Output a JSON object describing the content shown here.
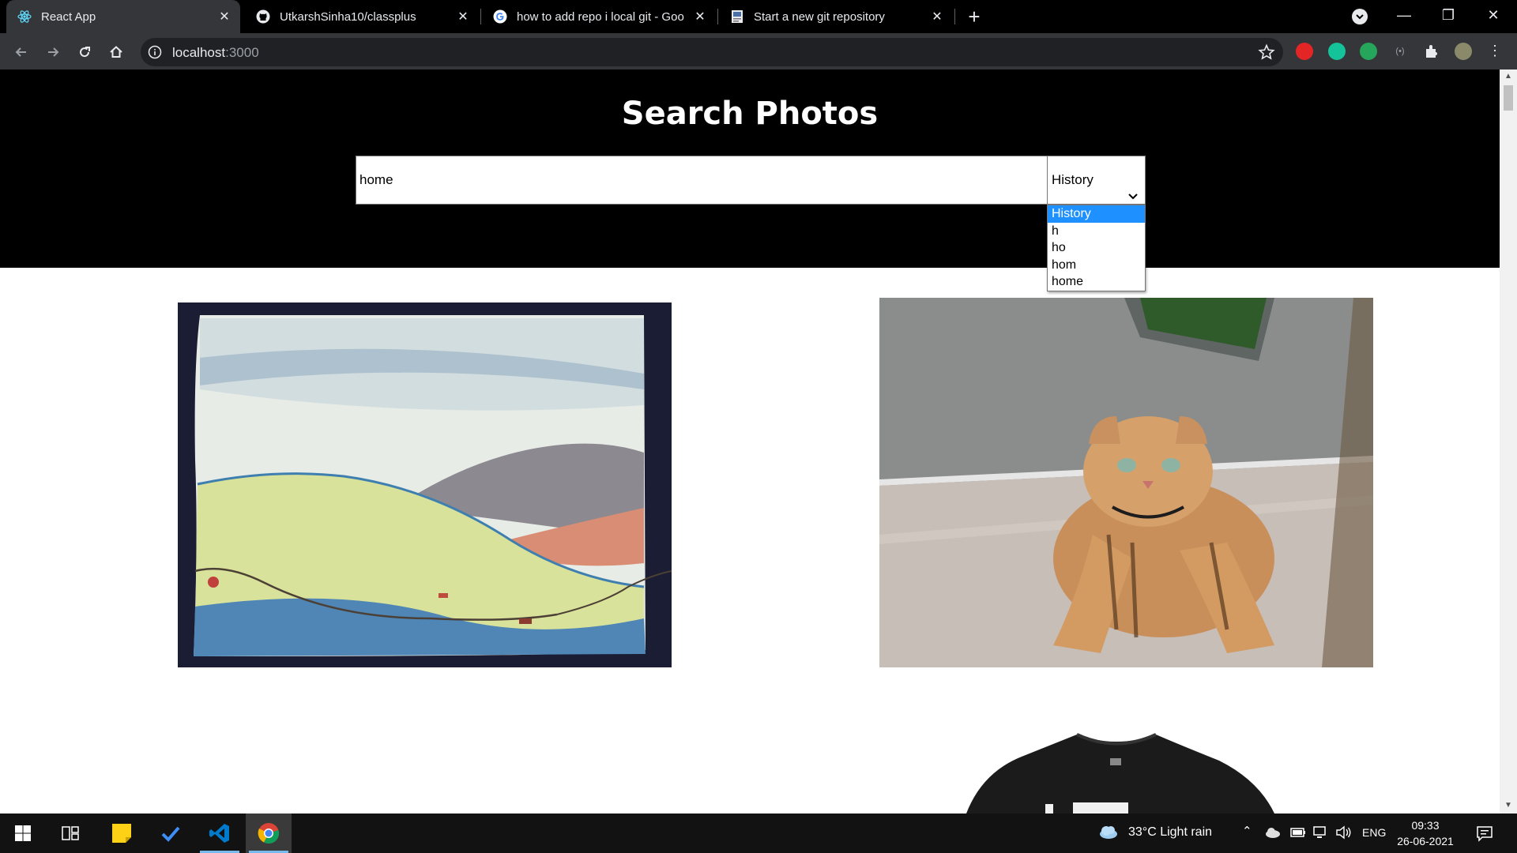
{
  "browser": {
    "tabs": [
      {
        "title": "React App",
        "icon": "react-icon",
        "active": true
      },
      {
        "title": "UtkarshSinha10/classplus",
        "icon": "github-icon",
        "active": false
      },
      {
        "title": "how to add repo i local git - Goo",
        "icon": "google-icon",
        "active": false
      },
      {
        "title": "Start a new git repository",
        "icon": "page-icon",
        "active": false
      }
    ],
    "url_host": "localhost",
    "url_port": ":3000"
  },
  "page": {
    "title": "Search Photos",
    "search": {
      "value": "home"
    },
    "select": {
      "selected": "History",
      "options": [
        "History",
        "h",
        "ho",
        "hom",
        "home"
      ]
    }
  },
  "taskbar": {
    "weather": "33°C  Light rain",
    "language": "ENG",
    "time": "09:33",
    "date": "26-06-2021"
  },
  "colors": {
    "highlight": "#1e90ff",
    "hero_bg": "#000000",
    "vscode": "#007acc"
  }
}
